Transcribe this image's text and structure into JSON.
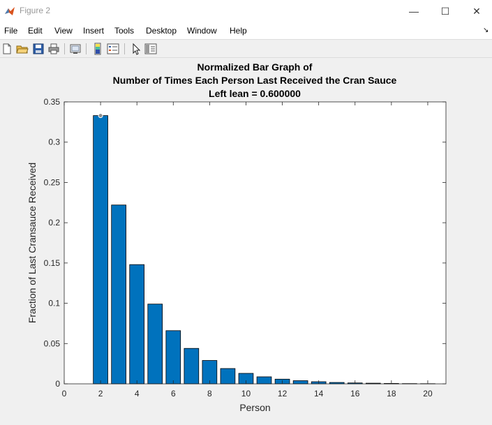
{
  "window": {
    "title": "Figure 2",
    "controls": {
      "minimize": "—",
      "maximize": "☐",
      "close": "✕"
    }
  },
  "menu": {
    "items": [
      "File",
      "Edit",
      "View",
      "Insert",
      "Tools",
      "Desktop",
      "Window",
      "Help"
    ],
    "dock_icon": "dock-arrow-icon"
  },
  "toolbar": {
    "buttons": [
      {
        "name": "new-figure",
        "icon": "new-file-icon"
      },
      {
        "name": "open-file",
        "icon": "folder-open-icon"
      },
      {
        "name": "save-figure",
        "icon": "save-disk-icon"
      },
      {
        "name": "print-figure",
        "icon": "printer-icon"
      },
      {
        "name": "link-plot",
        "icon": "link-plot-icon"
      },
      {
        "name": "insert-colorbar",
        "icon": "colorbar-icon"
      },
      {
        "name": "insert-legend",
        "icon": "legend-icon"
      },
      {
        "name": "edit-plot",
        "icon": "cursor-arrow-icon"
      },
      {
        "name": "property-inspector",
        "icon": "property-panel-icon"
      }
    ]
  },
  "colors": {
    "bar_fill": "#0072bd",
    "bar_edge": "#000000",
    "axes_bg": "#ffffff",
    "axes_line": "#262626",
    "marker": "#8c8c8c"
  },
  "chart_data": {
    "type": "bar",
    "title": [
      "Normalized Bar Graph of",
      "Number of Times Each Person Last Received the Cran Sauce",
      "Left lean = 0.600000"
    ],
    "xlabel": "Person",
    "ylabel": "Fraction of Last Cransauce Received",
    "xlim": [
      0,
      21
    ],
    "ylim": [
      0,
      0.35
    ],
    "xticks": [
      0,
      2,
      4,
      6,
      8,
      10,
      12,
      14,
      16,
      18,
      20
    ],
    "yticks": [
      0,
      0.05,
      0.1,
      0.15,
      0.2,
      0.25,
      0.3,
      0.35
    ],
    "ytick_labels": [
      "0",
      "0.05",
      "0.1",
      "0.15",
      "0.2",
      "0.25",
      "0.3",
      "0.35"
    ],
    "x": [
      2,
      3,
      4,
      5,
      6,
      7,
      8,
      9,
      10,
      11,
      12,
      13,
      14,
      15,
      16,
      17,
      18,
      19,
      20
    ],
    "values": [
      0.333,
      0.222,
      0.148,
      0.099,
      0.066,
      0.044,
      0.029,
      0.019,
      0.013,
      0.0087,
      0.0058,
      0.0039,
      0.0026,
      0.0017,
      0.0011,
      0.0008,
      0.0005,
      0.0003,
      0.0002
    ],
    "grid": false,
    "datatip": {
      "x": 2,
      "y": 0.333
    }
  }
}
